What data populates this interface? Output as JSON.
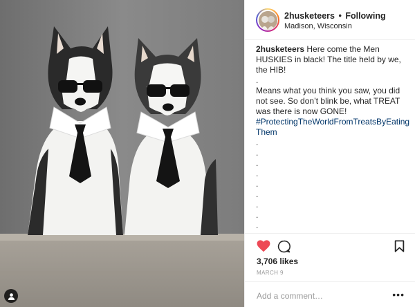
{
  "post": {
    "username": "2husketeers",
    "follow_separator": "•",
    "follow_status": "Following",
    "location": "Madison, Wisconsin"
  },
  "caption": {
    "username": "2husketeers",
    "text1": "Here come the Men HUSKIES in black! The title held by we, the HIB!",
    "dot": ".",
    "text2": "Means what you think you saw, you did not see. So don’t blink be, what TREAT was there is now GONE!",
    "hashtag": "#ProtectingTheWorldFromTreatsByEatingThem",
    "trailing_dots": [
      ".",
      ".",
      ".",
      ".",
      ".",
      ".",
      ".",
      ".",
      ".",
      ".",
      ".",
      "."
    ]
  },
  "actions": {
    "likes": "3,706 likes",
    "date": "MARCH 9",
    "comment_placeholder": "Add a comment…",
    "more": "•••"
  },
  "icons": {
    "like": "heart-icon",
    "comment": "comment-icon",
    "save": "bookmark-icon",
    "user_tag": "user-tag-icon",
    "more": "more-options-icon"
  },
  "colors": {
    "like_red": "#ed4956",
    "hashtag_blue": "#003569",
    "meta_gray": "#999999"
  }
}
